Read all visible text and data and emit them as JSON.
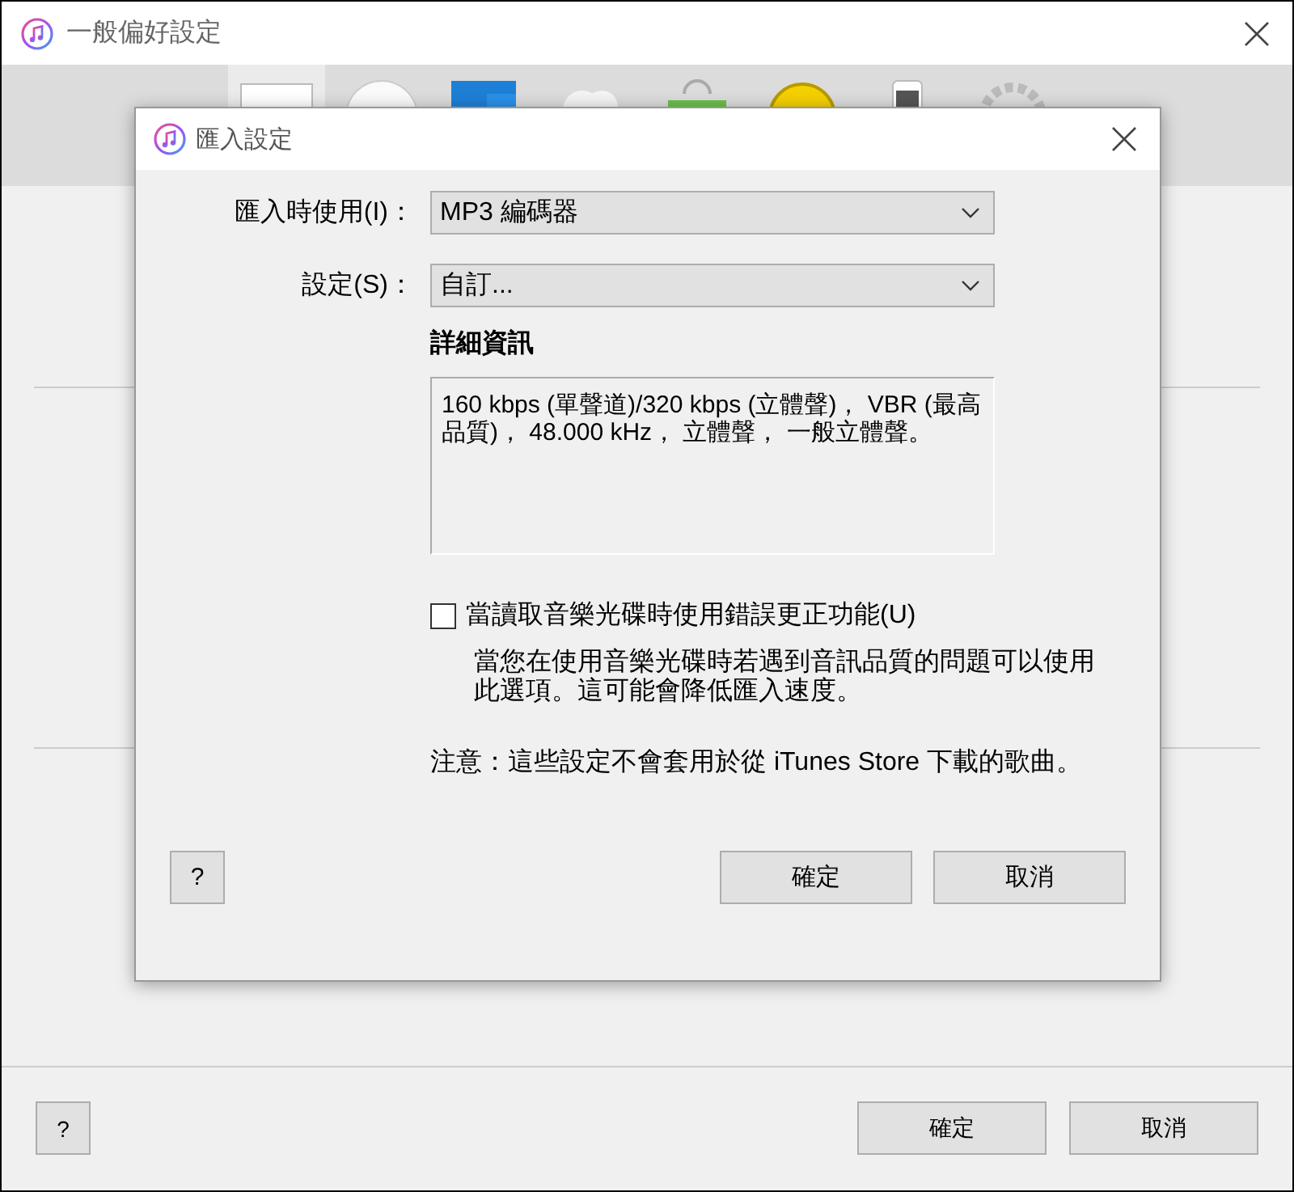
{
  "window": {
    "title": "一般偏好設定",
    "toolbar": [
      {
        "kind": "panel",
        "selected": true
      },
      {
        "kind": "play",
        "selected": false
      },
      {
        "kind": "folder",
        "selected": false
      },
      {
        "kind": "cloud",
        "selected": false
      },
      {
        "kind": "bag",
        "selected": false
      },
      {
        "kind": "smiley",
        "selected": false
      },
      {
        "kind": "phone",
        "selected": false
      },
      {
        "kind": "gear",
        "selected": false
      }
    ],
    "buttons": {
      "help": "?",
      "ok": "確定",
      "cancel": "取消"
    }
  },
  "dialog": {
    "title": "匯入設定",
    "fields": [
      {
        "label": "匯入時使用(I)：",
        "value": "MP3 編碼器"
      },
      {
        "label": "設定(S)：",
        "value": "自訂..."
      }
    ],
    "details_heading": "詳細資訊",
    "details": "160 kbps (單聲道)/320 kbps (立體聲)， VBR (最高品質)， 48.000 kHz， 立體聲， 一般立體聲。",
    "checkbox": {
      "label": "當讀取音樂光碟時使用錯誤更正功能(U)",
      "checked": false
    },
    "help_text": "當您在使用音樂光碟時若遇到音訊品質的問題可以使用此選項。這可能會降低匯入速度。",
    "note": "注意：這些設定不會套用於從 iTunes Store 下載的歌曲。",
    "buttons": {
      "help": "?",
      "ok": "確定",
      "cancel": "取消"
    }
  }
}
